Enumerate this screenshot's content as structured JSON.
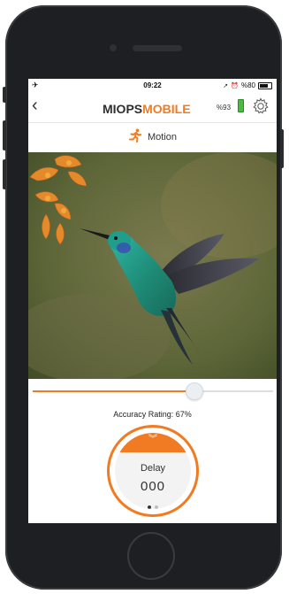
{
  "status_bar": {
    "time": "09:22",
    "right_text": "%80"
  },
  "header": {
    "brand_part1": "MIOPS",
    "brand_part2": "MOBILE",
    "device_battery": "%93"
  },
  "mode": {
    "label": "Motion",
    "icon": "running-man-icon"
  },
  "sensitivity_slider": {
    "value_fraction": 0.67
  },
  "accuracy": {
    "text": "Accuracy Rating: 67%"
  },
  "delay_dial": {
    "label": "Delay",
    "value": "000",
    "page_dots": 2,
    "active_dot": 0
  },
  "colors": {
    "accent": "#f07b22",
    "brand_dark": "#2e2e2e",
    "battery_green": "#4cb944"
  }
}
